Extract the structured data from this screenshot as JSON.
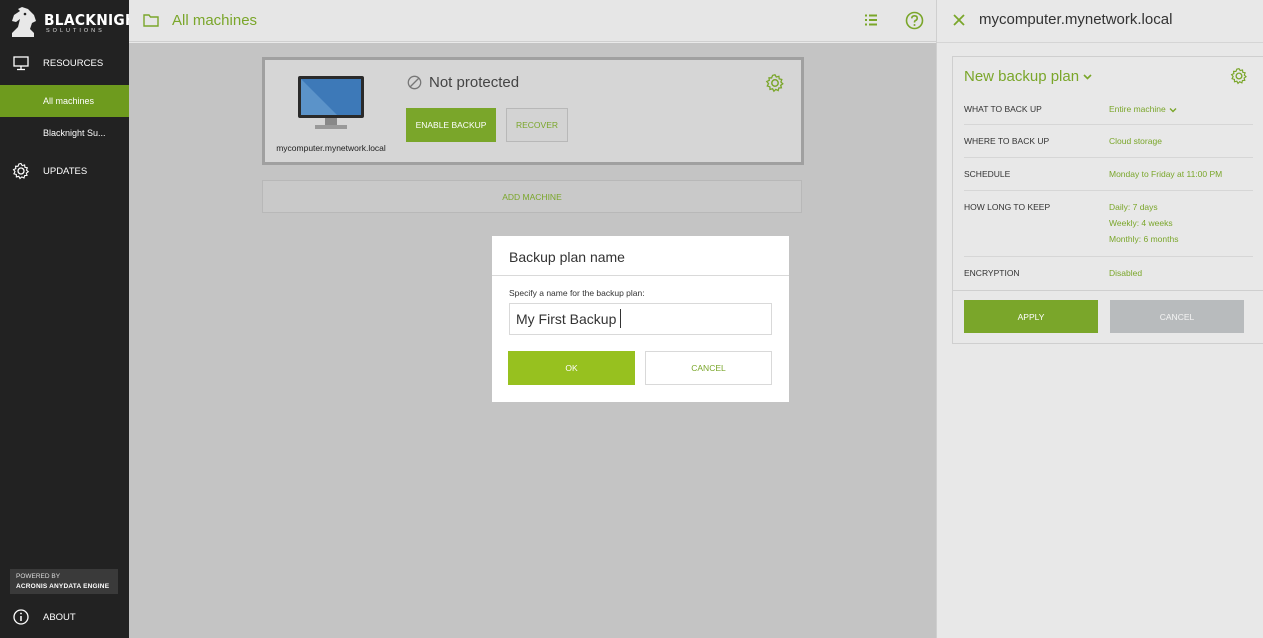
{
  "brand": {
    "name": "BLACKNIGHT",
    "sub": "SOLUTIONS",
    "accent": "#7aa62a",
    "accent_bright": "#97c11f",
    "sidebar_bg": "#222222"
  },
  "sidebar": {
    "resources": "RESOURCES",
    "items": [
      {
        "label": "All machines",
        "active": true
      },
      {
        "label": "Blacknight Su..."
      }
    ],
    "updates": "UPDATES",
    "powered_by": "POWERED BY",
    "engine": "ACRONIS ANYDATA ENGINE",
    "about": "ABOUT"
  },
  "topbar": {
    "title": "All machines",
    "icons": [
      "folder-icon",
      "list-icon",
      "help-icon"
    ]
  },
  "machine": {
    "name": "mycomputer.mynetwork.local",
    "status": "Not protected",
    "enable_backup": "ENABLE BACKUP",
    "recover": "RECOVER"
  },
  "add_machine": "ADD MACHINE",
  "dialog": {
    "title": "Backup plan name",
    "label": "Specify a name for the backup plan:",
    "value": "My First Backup",
    "ok": "OK",
    "cancel": "CANCEL"
  },
  "panel": {
    "title": "mycomputer.mynetwork.local",
    "plan_name": "New backup plan",
    "rows": [
      {
        "key": "WHAT TO BACK UP",
        "value": "Entire machine"
      },
      {
        "key": "WHERE TO BACK UP",
        "value": "Cloud storage"
      },
      {
        "key": "SCHEDULE",
        "value": "Monday to Friday at 11:00 PM"
      },
      {
        "key": "HOW LONG TO KEEP",
        "values": [
          "Daily: 7 days",
          "Weekly: 4 weeks",
          "Monthly: 6 months"
        ]
      },
      {
        "key": "ENCRYPTION",
        "value": "Disabled"
      }
    ],
    "apply": "APPLY",
    "cancel": "CANCEL"
  }
}
